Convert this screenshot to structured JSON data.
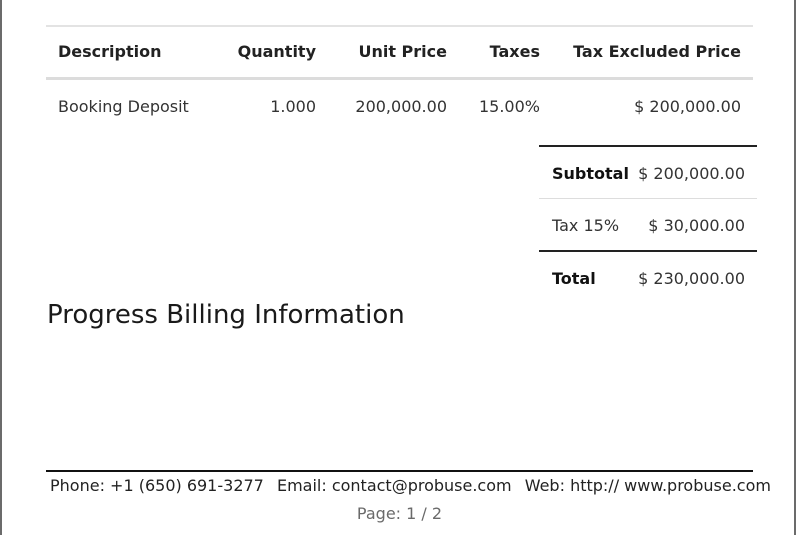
{
  "lines": {
    "headers": {
      "description": "Description",
      "quantity": "Quantity",
      "unit_price": "Unit Price",
      "taxes": "Taxes",
      "tax_excluded_price": "Tax Excluded Price"
    },
    "rows": [
      {
        "description": "Booking Deposit",
        "quantity": "1.000",
        "unit_price": "200,000.00",
        "taxes": "15.00%",
        "tax_excluded_price": "$ 200,000.00"
      }
    ]
  },
  "totals": {
    "subtotal_label": "Subtotal",
    "subtotal_value": "$ 200,000.00",
    "tax_label": "Tax 15%",
    "tax_value": "$ 30,000.00",
    "total_label": "Total",
    "total_value": "$ 230,000.00"
  },
  "section_title": "Progress Billing Information",
  "footer": {
    "phone": "Phone: +1 (650) 691-3277",
    "email": "Email: contact@probuse.com",
    "web": "Web: http:// www.probuse.com",
    "page": "Page: 1 / 2"
  }
}
